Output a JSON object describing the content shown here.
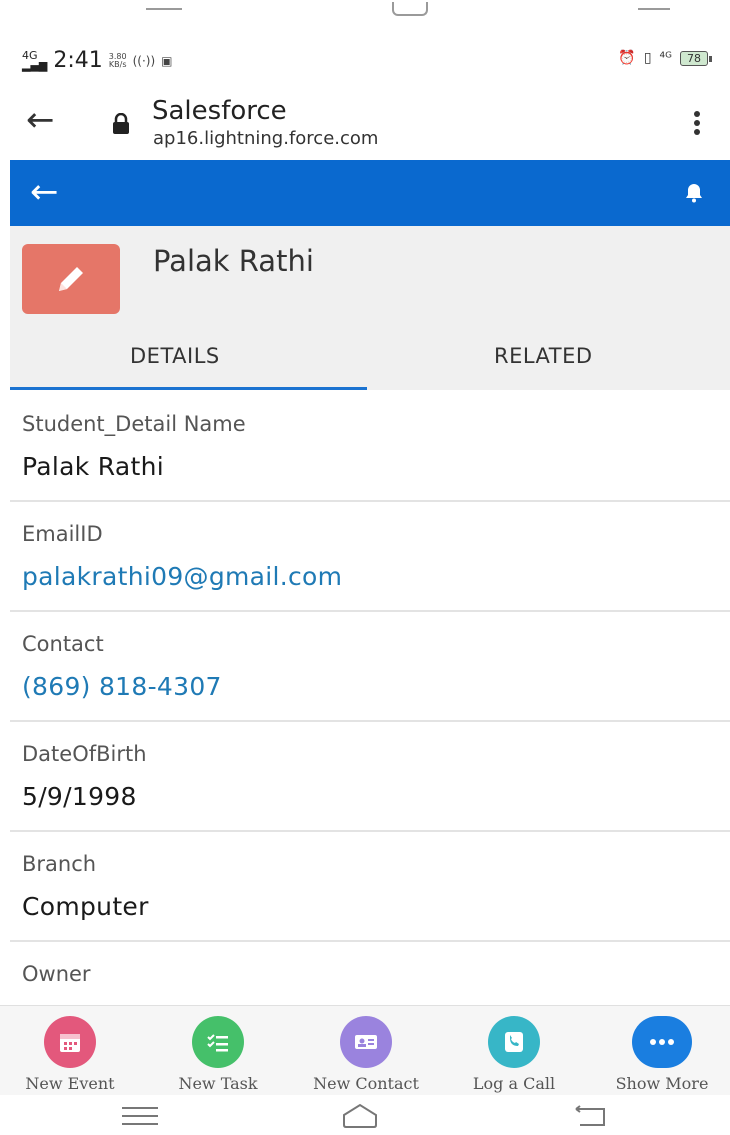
{
  "status_bar": {
    "network": "4G",
    "time": "2:41",
    "speed": "3.80",
    "speed_unit": "KB/s",
    "battery": "78"
  },
  "browser": {
    "title": "Salesforce",
    "url": "ap16.lightning.force.com"
  },
  "colors": {
    "header_blue": "#0a69cf",
    "record_icon": "#e57668",
    "link": "#1f7ab5",
    "event": "#e3587c",
    "task": "#45c06a",
    "contact": "#9a83de",
    "call": "#37b6c7",
    "more": "#1a7ee0"
  },
  "record": {
    "name": "Palak Rathi",
    "icon": "pencil-icon"
  },
  "tabs": {
    "details": "DETAILS",
    "related": "RELATED"
  },
  "fields": {
    "name": {
      "label": "Student_Detail Name",
      "value": "Palak Rathi"
    },
    "email": {
      "label": "EmailID",
      "value": "palakrathi09@gmail.com"
    },
    "contact": {
      "label": "Contact",
      "value": "(869) 818-4307"
    },
    "dob": {
      "label": "DateOfBirth",
      "value": "5/9/1998"
    },
    "branch": {
      "label": "Branch",
      "value": "Computer"
    },
    "owner": {
      "label": "Owner"
    }
  },
  "actions": {
    "new_event": "New Event",
    "new_task": "New Task",
    "new_contact": "New Contact",
    "log_call": "Log a Call",
    "show_more": "Show More"
  }
}
